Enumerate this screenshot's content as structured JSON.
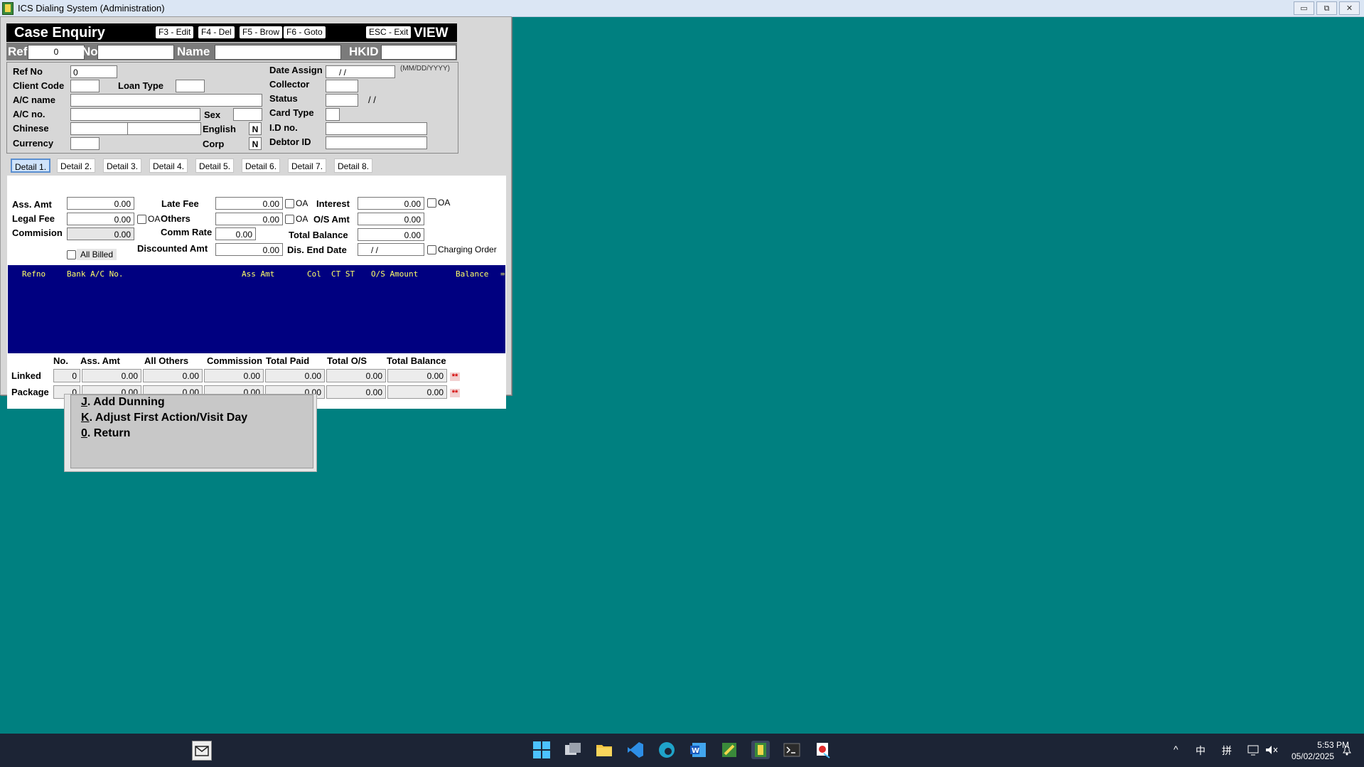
{
  "window": {
    "title": "ICS Dialing System (Administration)",
    "min": "▭",
    "restore": "⧉",
    "close": "✕"
  },
  "header": {
    "title": "Case Enquiry",
    "fkeys": [
      "F3 - Edit",
      "F4 - Del",
      "F5 - Brow",
      "F6 - Goto"
    ],
    "esc": "ESC - Exit",
    "mode": "VIEW"
  },
  "refbar": {
    "ref_label": "Ref",
    "ref_value": "0",
    "no_label": "No",
    "no_value": "",
    "name_label": "Name",
    "name_value": "",
    "hkid_label": "HKID",
    "hkid_value": ""
  },
  "info": {
    "ref_no_label": "Ref No",
    "ref_no": "0",
    "client_code_label": "Client Code",
    "client_code": "",
    "loan_type_label": "Loan Type",
    "loan_type": "",
    "ac_name_label": "A/C name",
    "ac_name": "",
    "ac_no_label": "A/C no.",
    "ac_no": "",
    "sex_label": "Sex",
    "sex": "",
    "chinese_label": "Chinese",
    "chinese1": "",
    "chinese2": "",
    "english_label": "English",
    "english": "N",
    "currency_label": "Currency",
    "currency": "",
    "corp_label": "Corp",
    "corp": "N",
    "date_assign_label": "Date Assign",
    "date_assign": "/    /",
    "date_fmt": "(MM/DD/YYYY)",
    "collector_label": "Collector",
    "collector": "",
    "status_label": "Status",
    "status": "",
    "status_date": "/  /",
    "card_type_label": "Card Type",
    "card_type": "",
    "id_no_label": "I.D no.",
    "id_no": "",
    "debtor_id_label": "Debtor ID",
    "debtor_id": ""
  },
  "tabs": [
    "Detail 1.",
    "Detail 2.",
    "Detail 3.",
    "Detail 4.",
    "Detail 5.",
    "Detail 6.",
    "Detail 7.",
    "Detail 8."
  ],
  "detail": {
    "ass_amt_label": "Ass. Amt",
    "ass_amt": "0.00",
    "legal_fee_label": "Legal Fee",
    "legal_fee": "0.00",
    "commision_label": "Commision",
    "commision": "0.00",
    "all_billed_label": "All Billed",
    "late_fee_label": "Late Fee",
    "late_fee": "0.00",
    "others_label": "Others",
    "others": "0.00",
    "comm_rate_label": "Comm Rate",
    "comm_rate": "0.00",
    "discounted_amt_label": "Discounted Amt",
    "discounted_amt": "0.00",
    "oa_label": "OA",
    "interest_label": "Interest",
    "interest": "0.00",
    "os_amt_label": "O/S Amt",
    "os_amt": "0.00",
    "total_balance_label": "Total Balance",
    "total_balance": "0.00",
    "dis_end_date_label": "Dis. End Date",
    "dis_end_date": "/    /",
    "charging_order_label": "Charging Order"
  },
  "grid": {
    "headers": [
      "Refno",
      "Bank A/C No.",
      "Ass Amt",
      "Col",
      "CT ST",
      "O/S Amount",
      "Balance",
      "="
    ]
  },
  "summary": {
    "headers": [
      "No.",
      "Ass. Amt",
      "All Others",
      "Commission",
      "Total Paid",
      "Total O/S",
      "Total Balance"
    ],
    "rows": [
      {
        "label": "Linked",
        "values": [
          "0",
          "0.00",
          "0.00",
          "0.00",
          "0.00",
          "0.00",
          "0.00"
        ],
        "flag": "**"
      },
      {
        "label": "Package",
        "values": [
          "0",
          "0.00",
          "0.00",
          "0.00",
          "0.00",
          "0.00",
          "0.00"
        ],
        "flag": "**"
      }
    ]
  },
  "menu": {
    "items": [
      {
        "key": "J",
        "text": ". Add Dunning"
      },
      {
        "key": "K",
        "text": ". Adjust First Action/Visit Day"
      },
      {
        "key": "0",
        "text": ". Return"
      }
    ]
  },
  "taskbar": {
    "time": "5:53 PM",
    "date": "05/02/2025",
    "ime1": "中",
    "ime2": "拼",
    "chevron": "^"
  }
}
